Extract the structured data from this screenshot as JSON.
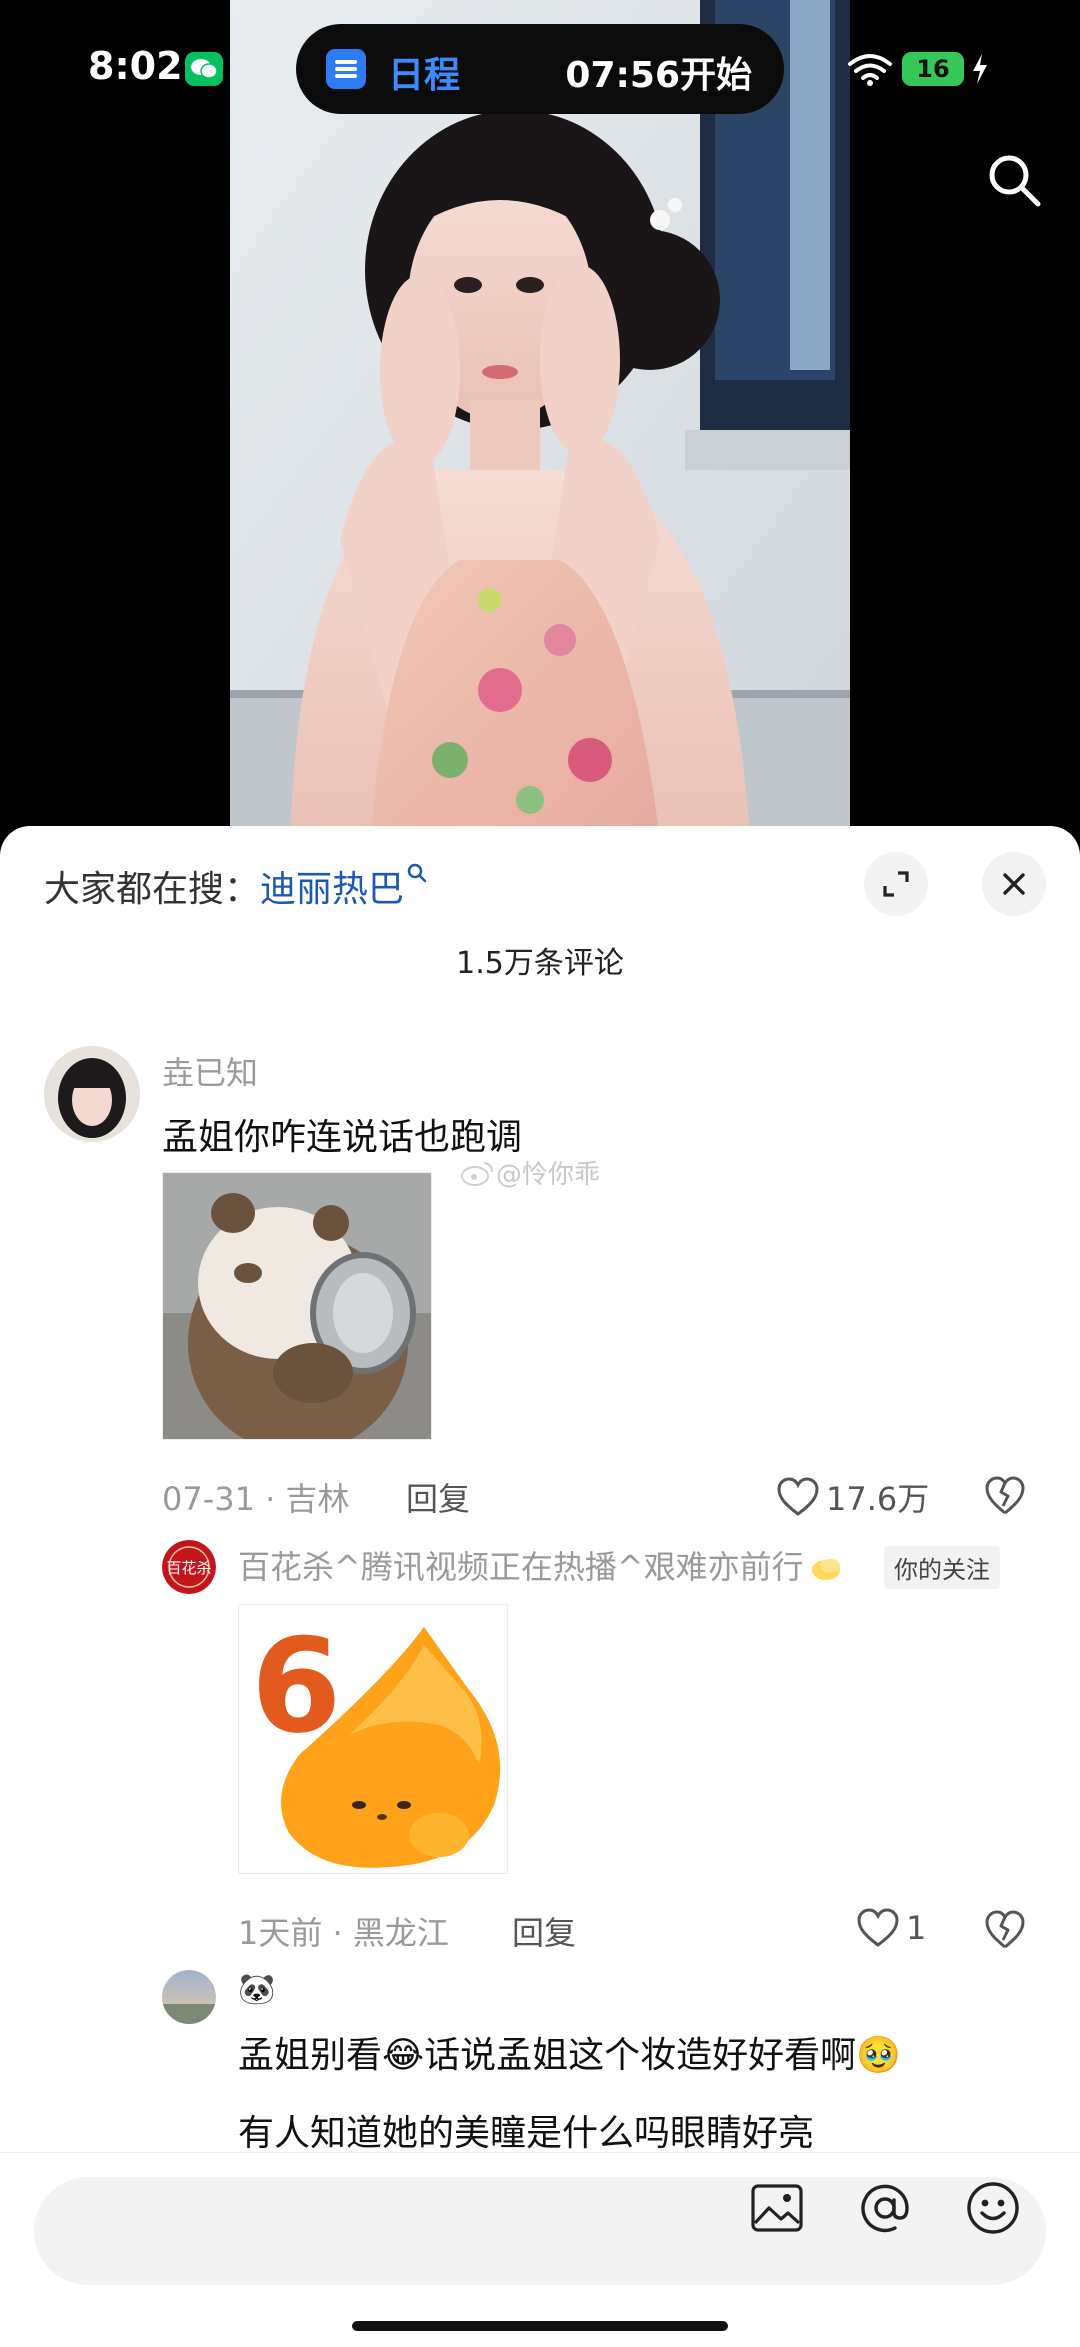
{
  "status_bar": {
    "time": "8:02",
    "battery": "16"
  },
  "island": {
    "app_label": "日程",
    "time_text": "07:56开始"
  },
  "hot_search": {
    "prefix": "大家都在搜：",
    "keyword": "迪丽热巴"
  },
  "comments_header": {
    "count_text": "1.5万条评论"
  },
  "comments": [
    {
      "user": "垚已知",
      "text": "孟姐你咋连说话也跑调",
      "date": "07-31",
      "location": "吉林",
      "reply_label": "回复",
      "likes": "17.6万",
      "watermark": "@怜你乖"
    },
    {
      "user": "百花杀^腾讯视频正在热播^艰难亦前行",
      "tag": "你的关注",
      "sticker_number": "6",
      "date": "1天前",
      "location": "黑龙江",
      "reply_label": "回复",
      "likes": "1",
      "avatar_text": "百花杀"
    },
    {
      "user_emoji": "🐼",
      "line1_a": "孟姐别看",
      "emoji1": "😂",
      "line1_b": "话说孟姐这个妆造好好看啊",
      "emoji2": "🥹",
      "line2": "有人知道她的美瞳是什么吗眼睛好亮"
    }
  ],
  "separator": "·",
  "colors": {
    "link": "#1d59b3",
    "meta": "#9a9a9a",
    "wechat": "#07c160",
    "battery": "#36c759",
    "calendar": "#2e7cf6"
  }
}
